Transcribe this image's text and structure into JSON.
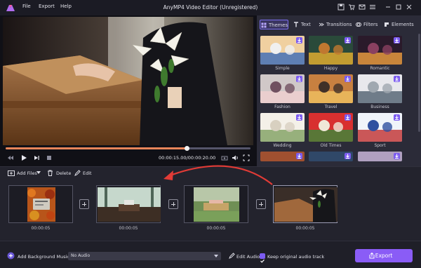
{
  "menu": {
    "file": "File",
    "export": "Export",
    "help": "Help"
  },
  "window": {
    "title": "AnyMP4 Video Editor (Unregistered)"
  },
  "player": {
    "timecode": "00:00:15.00/00:00:20.00",
    "progress": 0.74
  },
  "tabs": {
    "themes": "Themes",
    "text": "Text",
    "transitions": "Transitions",
    "filters": "Filters",
    "elements": "Elements"
  },
  "themes": [
    "Simple",
    "Happy",
    "Romantic",
    "Fashion",
    "Travel",
    "Business",
    "Wedding",
    "Old Times",
    "Sport"
  ],
  "toolbar": {
    "add_files": "Add Files",
    "delete": "Delete",
    "edit": "Edit"
  },
  "clips": [
    {
      "duration": "00:00:05"
    },
    {
      "duration": "00:00:05"
    },
    {
      "duration": "00:00:05"
    },
    {
      "duration": "00:00:05"
    }
  ],
  "bottom": {
    "add_music_label": "Add Background Music:",
    "audio_value": "No Audio",
    "edit_audio": "Edit Audio",
    "keep_audio": "Keep original audio track",
    "export": "Export"
  },
  "colors": {
    "accent": "#8a5cf6",
    "progress": "#e8855a",
    "arrow": "#e23b36"
  }
}
